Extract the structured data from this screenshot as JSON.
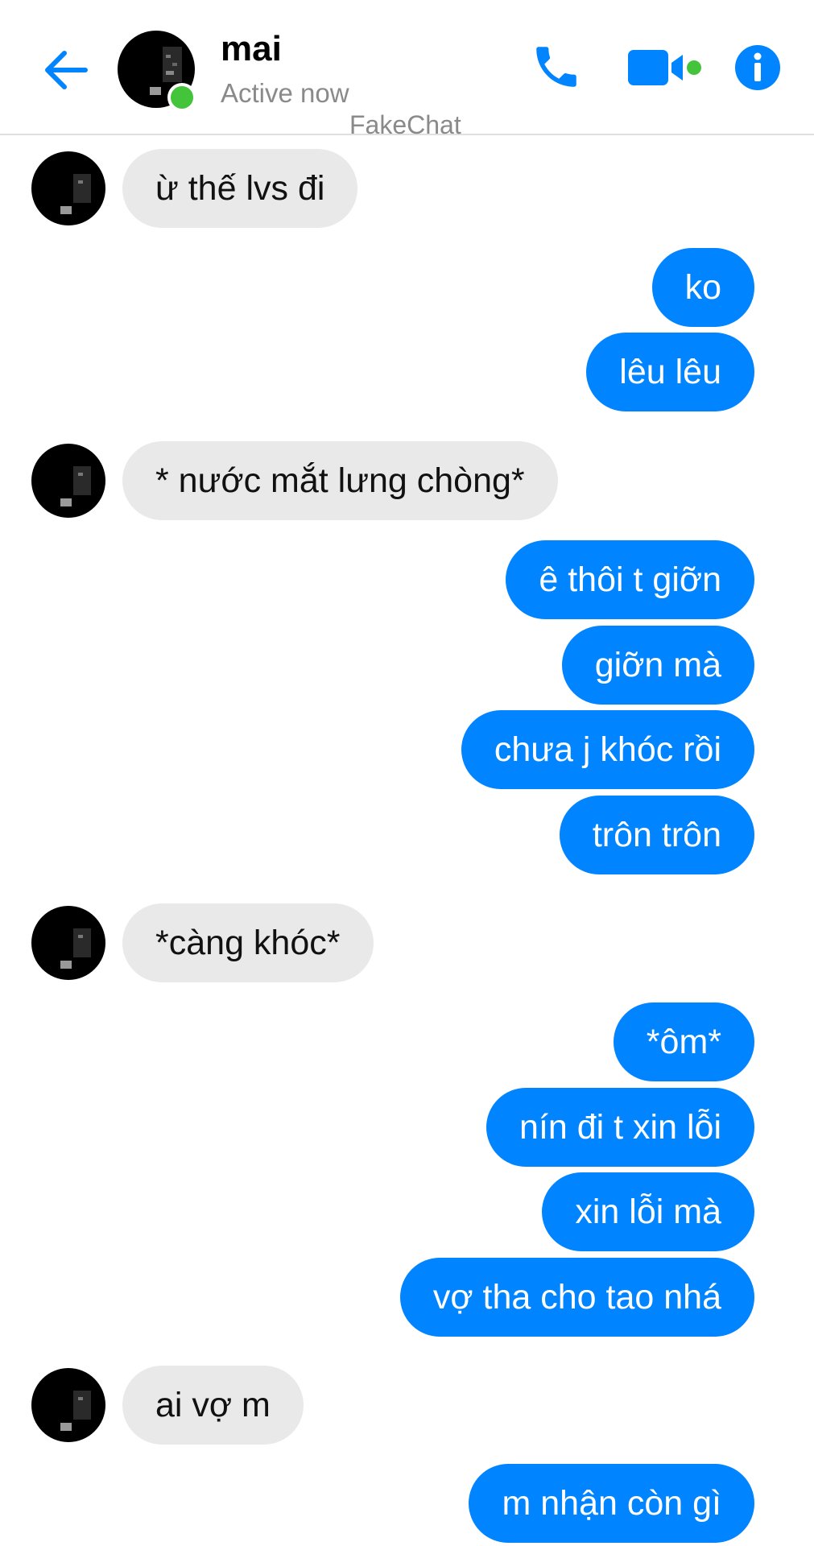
{
  "header": {
    "contact_name": "mai",
    "status": "Active now",
    "watermark": "FakeChat"
  },
  "colors": {
    "accent": "#0084ff",
    "online": "#44c43b",
    "incoming_bubble": "#e9e9e9",
    "outgoing_bubble": "#0084ff"
  },
  "icons": [
    "arrow-left-icon",
    "phone-icon",
    "video-camera-icon",
    "info-icon"
  ],
  "messages": [
    {
      "direction": "incoming",
      "text": "ừ thế lvs đi"
    },
    {
      "direction": "outgoing",
      "text": "ko"
    },
    {
      "direction": "outgoing",
      "text": "lêu lêu"
    },
    {
      "direction": "incoming",
      "text": "* nước mắt lưng chòng*"
    },
    {
      "direction": "outgoing",
      "text": "ê thôi t giỡn"
    },
    {
      "direction": "outgoing",
      "text": "giỡn mà"
    },
    {
      "direction": "outgoing",
      "text": "chưa j khóc rồi"
    },
    {
      "direction": "outgoing",
      "text": "trôn trôn"
    },
    {
      "direction": "incoming",
      "text": "*càng khóc*"
    },
    {
      "direction": "outgoing",
      "text": "*ôm*"
    },
    {
      "direction": "outgoing",
      "text": "nín đi t xin lỗi"
    },
    {
      "direction": "outgoing",
      "text": "xin lỗi mà"
    },
    {
      "direction": "outgoing",
      "text": "vợ tha cho tao nhá"
    },
    {
      "direction": "incoming",
      "text": "ai vợ m"
    },
    {
      "direction": "outgoing",
      "text": "m nhận còn gì"
    }
  ]
}
